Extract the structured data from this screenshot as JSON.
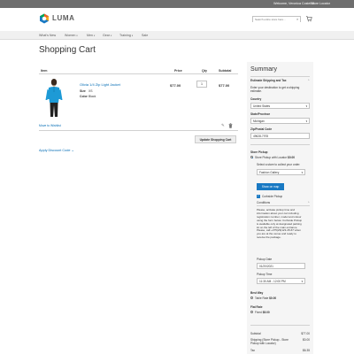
{
  "topbar": {
    "welcome": "Welcome, Veronica Costello!",
    "switch_label": "Store Locator"
  },
  "header": {
    "logo_text": "LUMA",
    "search_placeholder": "Search entire store here...",
    "logo_colors": [
      "#f26322",
      "#f7a81b",
      "#00a651",
      "#1979c3"
    ]
  },
  "nav": {
    "items": [
      {
        "label": "What's New"
      },
      {
        "label": "Women"
      },
      {
        "label": "Men"
      },
      {
        "label": "Gear"
      },
      {
        "label": "Training"
      },
      {
        "label": "Sale"
      }
    ]
  },
  "page": {
    "title": "Shopping Cart"
  },
  "cart": {
    "headers": {
      "item": "Item",
      "price": "Price",
      "qty": "Qty",
      "subtotal": "Subtotal"
    },
    "item": {
      "name": "Olivia 1/4 Zip Light Jacket",
      "size_label": "Size",
      "size": "XS",
      "color_label": "Color",
      "color": "Black",
      "price": "$77.00",
      "qty": "1",
      "subtotal": "$77.00"
    },
    "move_to_wishlist": "Move to Wishlist",
    "update_button": "Update Shopping Cart",
    "discount_link": "Apply Discount Code"
  },
  "summary": {
    "title": "Summary",
    "estimate_heading": "Estimate Shipping and Tax",
    "estimate_text": "Enter your destination to get a shipping estimate.",
    "country_label": "Country",
    "country_value": "United States",
    "state_label": "State/Province",
    "state_value": "Michigan",
    "zip_label": "Zip/Postal Code",
    "zip_value": "49628-7978",
    "store_pickup_heading": "Store Pickup",
    "store_pickup_option": "Store Pickup with Locator",
    "store_pickup_price": "$0.00",
    "select_store_label": "Select a store to collect your order:",
    "store_value": "Fashion Gallery",
    "show_map_button": "Show on map",
    "curbside_label": "Curbside Pickup",
    "conditions_label": "Conditions",
    "conditions_text": "Please, activate pickup time and information about your car including registration number, model and colour using the form below. Curbside Pickup is available only at designated parking lot on the left of the main entrance. Please, call +375(29)123-45-67 when you are at the venue and ready to receive the package.",
    "pickup_date_label": "Pickup Date",
    "pickup_date_value": "01/20/2021",
    "pickup_time_label": "Pickup Time",
    "pickup_time_value": "11:30 AM - 12:00 PM",
    "best_way_heading": "Best Way",
    "best_way_option": "Table Rate",
    "best_way_price": "$0.00",
    "flat_rate_heading": "Flat Rate",
    "flat_rate_option": "Fixed",
    "flat_rate_price": "$5.00",
    "subtotal_label": "Subtotal",
    "subtotal_value": "$77.00",
    "shipping_label": "Shipping (Store Pickup - Store Pickup with Locator)",
    "shipping_value": "$0.00",
    "tax_label": "Tax",
    "tax_value": "$6.35"
  }
}
